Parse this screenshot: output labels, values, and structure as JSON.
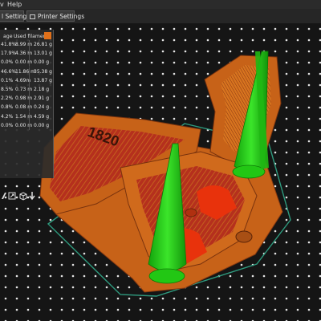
{
  "menu": {
    "help": "Help"
  },
  "tabs": [
    {
      "label": "l Settings"
    },
    {
      "label": "Printer Settings"
    }
  ],
  "stats_panel": {
    "header": {
      "left": "age",
      "used": "Used filament"
    },
    "rows": [
      {
        "pct": "41.8%",
        "time": "8.99 m",
        "used": "26.81 g"
      },
      {
        "pct": "17.9%",
        "time": "4.36 m",
        "used": "13.01 g"
      },
      {
        "pct": "0.0%",
        "time": "0.00 m",
        "used": "0.00 g"
      },
      {
        "pct": "46.6%",
        "time": "11.86 m",
        "used": "35.38 g"
      },
      {
        "pct": "0.1%",
        "time": "4.69m",
        "used": "13.87 g"
      },
      {
        "pct": "8.5%",
        "time": "0.73 m",
        "used": "2.18 g"
      },
      {
        "pct": "2.2%",
        "time": "0.98 m",
        "used": "2.91 g"
      },
      {
        "pct": "0.8%",
        "time": "0.08 m",
        "used": "0.24 g"
      },
      {
        "pct": "4.2%",
        "time": "1.54 m",
        "used": "4.59 g"
      },
      {
        "pct": "0.0%",
        "time": "0.00 m",
        "used": "0.00 g"
      }
    ]
  },
  "model_text": "1820",
  "colors": {
    "bed": "#151515",
    "bed_dots": "#e6e6e6",
    "model_perimeter": "#c76218",
    "model_infill": "#b5301d",
    "model_bridge": "#e8320c",
    "supports": "#22c714",
    "skirt": "#2e9a7e",
    "accent": "#e0701a"
  },
  "icons": [
    "tab-icon",
    "collapse-icon",
    "view-tool-icon",
    "export-icon",
    "cube-view-icon",
    "arrow-down-icon"
  ]
}
